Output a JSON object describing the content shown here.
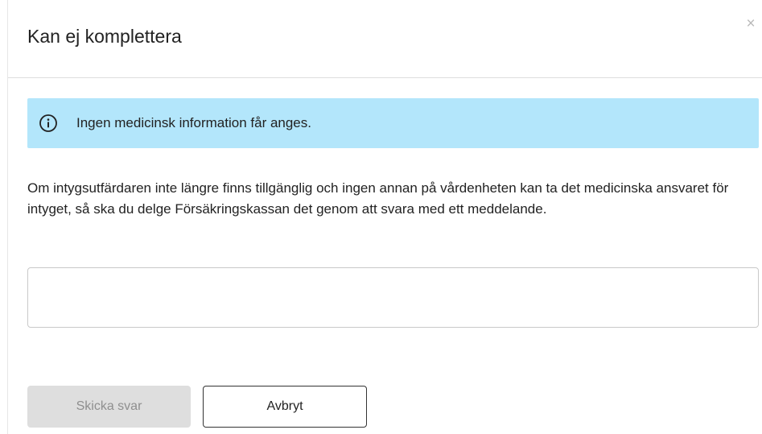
{
  "modal": {
    "title": "Kan ej komplettera",
    "close_symbol": "×",
    "info": {
      "icon": "info-circle-icon",
      "text": "Ingen medicinsk information får anges.",
      "background_color": "#b3e6fb"
    },
    "description": "Om intygsutfärdaren inte längre finns tillgänglig och ingen annan på vårdenheten kan ta det medicinska ansvaret för intyget, så ska du delge Försäkringskassan det genom att svara med ett meddelande.",
    "message_input": {
      "value": "",
      "placeholder": ""
    },
    "buttons": {
      "send_label": "Skicka svar",
      "send_disabled": true,
      "cancel_label": "Avbryt"
    }
  }
}
